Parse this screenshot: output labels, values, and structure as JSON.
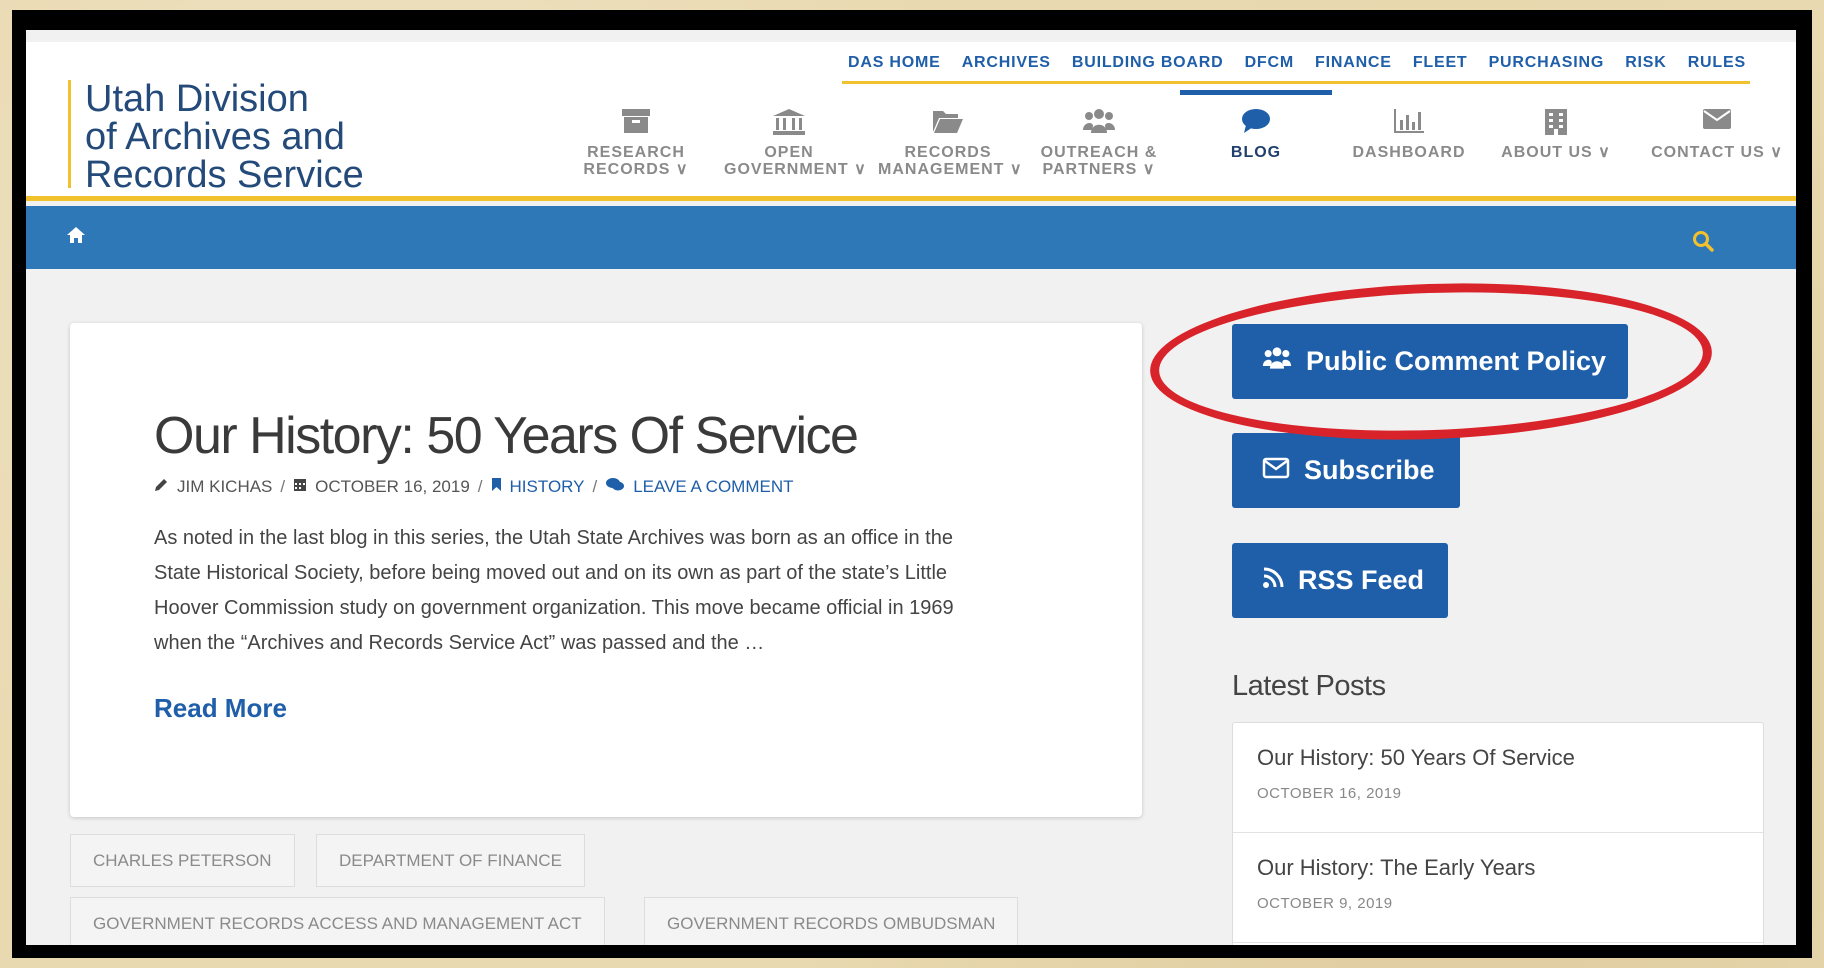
{
  "site": {
    "logo_lines": [
      "Utah Division",
      "of Archives and",
      "Records Service"
    ]
  },
  "top_nav": [
    "DAS HOME",
    "ARCHIVES",
    "BUILDING BOARD",
    "DFCM",
    "FINANCE",
    "FLEET",
    "PURCHASING",
    "RISK",
    "RULES"
  ],
  "main_nav": [
    {
      "line1": "RESEARCH",
      "line2": "RECORDS ∨",
      "icon": "archive-box-icon"
    },
    {
      "line1": "OPEN",
      "line2": "GOVERNMENT ∨",
      "icon": "institution-icon"
    },
    {
      "line1": "RECORDS",
      "line2": "MANAGEMENT ∨",
      "icon": "folder-open-icon"
    },
    {
      "line1": "OUTREACH &",
      "line2": "PARTNERS ∨",
      "icon": "users-icon"
    },
    {
      "line1": "BLOG",
      "line2": "",
      "icon": "comment-icon",
      "active": true
    },
    {
      "line1": "DASHBOARD",
      "line2": "",
      "icon": "bar-chart-icon"
    },
    {
      "line1": "ABOUT US ∨",
      "line2": "",
      "icon": "building-icon"
    },
    {
      "line1": "CONTACT US ∨",
      "line2": "",
      "icon": "envelope-icon"
    }
  ],
  "colors": {
    "brand_blue": "#1f5ea8",
    "bar_blue": "#2f78b7",
    "accent_gold": "#f2c12e",
    "highlight_red": "#d9232a"
  },
  "post": {
    "title": "Our History: 50 Years Of Service",
    "author": "JIM KICHAS",
    "date": "OCTOBER 16, 2019",
    "category": "HISTORY",
    "comment_link": "LEAVE A COMMENT",
    "excerpt_lines": [
      "As noted in the last blog in this series, the Utah State Archives was born as an office in the",
      "State Historical Society, before being moved out and on its own as part of the state’s Little",
      "Hoover Commission study on government organization. This move became official in 1969",
      "when the “Archives and Records Service Act” was passed and the …"
    ],
    "read_more": "Read More"
  },
  "tags": [
    "CHARLES PETERSON",
    "DEPARTMENT OF FINANCE",
    "GOVERNMENT RECORDS ACCESS AND MANAGEMENT ACT",
    "GOVERNMENT RECORDS OMBUDSMAN"
  ],
  "sidebar": {
    "buttons": [
      "Public Comment Policy",
      "Subscribe",
      "RSS Feed"
    ],
    "latest_title": "Latest Posts",
    "latest": [
      {
        "title": "Our History: 50 Years Of Service",
        "date": "OCTOBER 16, 2019"
      },
      {
        "title": "Our History: The Early Years",
        "date": "OCTOBER 9, 2019"
      }
    ]
  }
}
